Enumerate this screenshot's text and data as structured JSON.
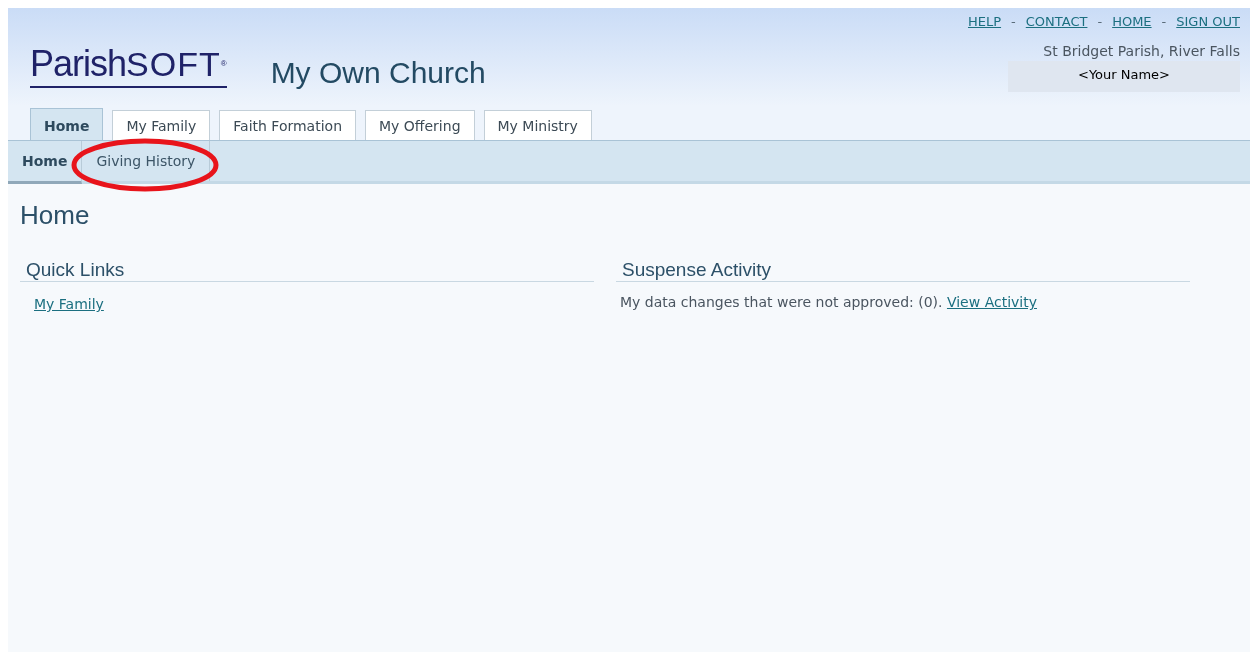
{
  "logo": {
    "bold": "Parish",
    "light": "SOFT",
    "mark": "®"
  },
  "church_name": "My Own Church",
  "top_links": [
    {
      "label": "HELP"
    },
    {
      "label": "CONTACT"
    },
    {
      "label": "HOME"
    },
    {
      "label": "SIGN OUT"
    }
  ],
  "separator": "-",
  "parish": "St Bridget Parish, River Falls",
  "user_name": "<Your Name>",
  "tabs": [
    {
      "label": "Home",
      "selected": true
    },
    {
      "label": "My Family",
      "selected": false
    },
    {
      "label": "Faith Formation",
      "selected": false
    },
    {
      "label": "My Offering",
      "selected": false
    },
    {
      "label": "My Ministry",
      "selected": false
    }
  ],
  "subtabs": [
    {
      "label": "Home",
      "selected": true,
      "circled": false
    },
    {
      "label": "Giving History",
      "selected": false,
      "circled": true
    }
  ],
  "page_title": "Home",
  "quick_links": {
    "title": "Quick Links",
    "links": [
      "My Family"
    ]
  },
  "suspense": {
    "title": "Suspense Activity",
    "text": "My data changes that were not approved: (0).",
    "link": "View Activity"
  }
}
